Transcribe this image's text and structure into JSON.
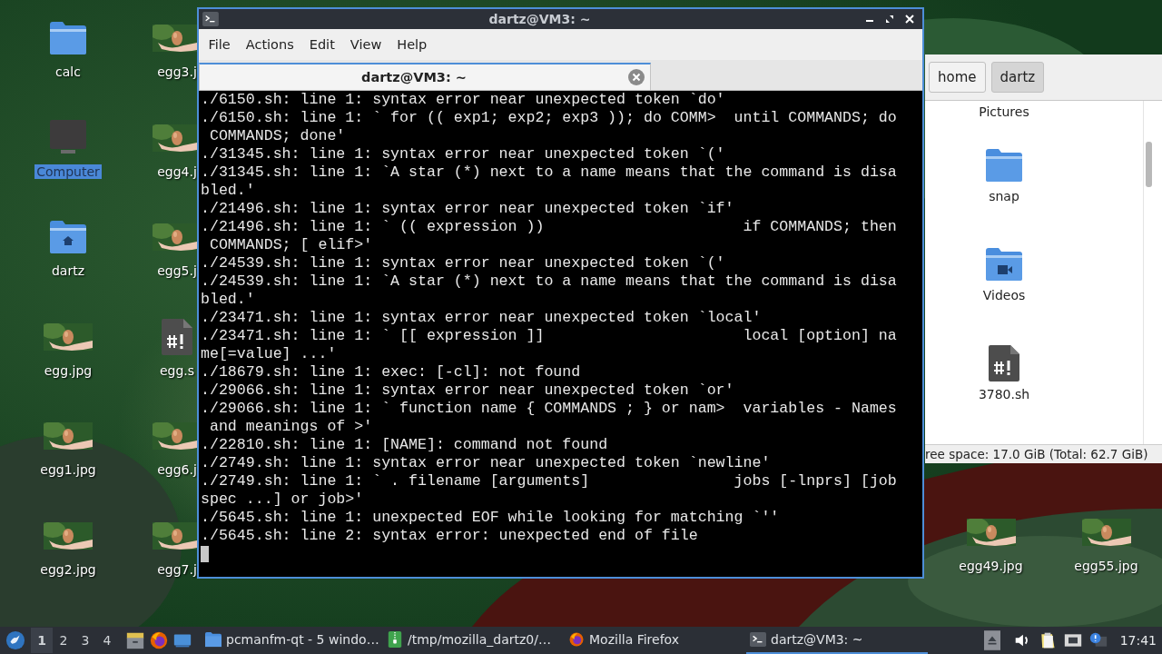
{
  "desktop": {
    "left_icons": [
      {
        "label": "calc",
        "kind": "folder",
        "selected": false
      },
      {
        "label": "Computer",
        "kind": "computer",
        "selected": true
      },
      {
        "label": "dartz",
        "kind": "home_folder",
        "selected": false
      },
      {
        "label": "egg.jpg",
        "selected": false
      },
      {
        "label": "egg1.jpg",
        "selected": false
      },
      {
        "label": "egg2.jpg",
        "selected": false
      },
      {
        "label": "egg3.j",
        "selected": false
      },
      {
        "label": "egg4.j",
        "selected": false
      },
      {
        "label": "egg5.j",
        "selected": false
      },
      {
        "label": "egg.s",
        "kind": "script",
        "selected": false
      },
      {
        "label": "egg6.j",
        "selected": false
      },
      {
        "label": "egg7.j",
        "selected": false
      }
    ],
    "right_icons": [
      {
        "label": "egg49.jpg",
        "selected": false
      },
      {
        "label": "egg55.jpg",
        "selected": false
      }
    ]
  },
  "file_manager": {
    "path_buttons": [
      {
        "label": "home",
        "selected": false
      },
      {
        "label": "dartz",
        "selected": true
      }
    ],
    "items": [
      {
        "label": "Pictures",
        "kind": "cut"
      },
      {
        "label": "snap",
        "kind": "folder"
      },
      {
        "label": "Videos",
        "kind": "video_folder"
      },
      {
        "label": "3780.sh",
        "kind": "script"
      }
    ],
    "status_bar": "ree space: 17.0 GiB (Total: 62.7 GiB)"
  },
  "terminal": {
    "title": "dartz@VM3: ~",
    "menu": [
      "File",
      "Actions",
      "Edit",
      "View",
      "Help"
    ],
    "tabs": [
      {
        "label": "dartz@VM3: ~",
        "selected": true
      }
    ],
    "lines": [
      "./6150.sh: line 1: syntax error near unexpected token `do'",
      "./6150.sh: line 1: ` for (( exp1; exp2; exp3 )); do COMM>  until COMMANDS; do",
      " COMMANDS; done'",
      "./31345.sh: line 1: syntax error near unexpected token `('",
      "./31345.sh: line 1: `A star (*) next to a name means that the command is disa",
      "bled.'",
      "./21496.sh: line 1: syntax error near unexpected token `if'",
      "./21496.sh: line 1: ` (( expression ))                      if COMMANDS; then",
      " COMMANDS; [ elif>'",
      "./24539.sh: line 1: syntax error near unexpected token `('",
      "./24539.sh: line 1: `A star (*) next to a name means that the command is disa",
      "bled.'",
      "./23471.sh: line 1: syntax error near unexpected token `local'",
      "./23471.sh: line 1: ` [[ expression ]]                      local [option] na",
      "me[=value] ...'",
      "./18679.sh: line 1: exec: [-cl]: not found",
      "./29066.sh: line 1: syntax error near unexpected token `or'",
      "./29066.sh: line 1: ` function name { COMMANDS ; } or nam>  variables - Names",
      " and meanings of >'",
      "./22810.sh: line 1: [NAME]: command not found",
      "./2749.sh: line 1: syntax error near unexpected token `newline'",
      "./2749.sh: line 1: ` . filename [arguments]                jobs [-lnprs] [job",
      "spec ...] or job>'",
      "./5645.sh: line 1: unexpected EOF while looking for matching `''",
      "./5645.sh: line 2: syntax error: unexpected end of file"
    ]
  },
  "taskbar": {
    "workspaces": [
      {
        "label": "1",
        "selected": true
      },
      {
        "label": "2",
        "selected": false
      },
      {
        "label": "3",
        "selected": false
      },
      {
        "label": "4",
        "selected": false
      }
    ],
    "tasks": [
      {
        "label": "pcmanfm-qt - 5 windo…",
        "kind": "folder",
        "selected": false
      },
      {
        "label": "/tmp/mozilla_dartz0/…",
        "kind": "archive",
        "selected": false
      },
      {
        "label": "Mozilla Firefox",
        "kind": "firefox",
        "selected": false
      },
      {
        "label": "dartz@VM3: ~",
        "kind": "terminal",
        "selected": true
      }
    ],
    "clock": "17:41"
  }
}
